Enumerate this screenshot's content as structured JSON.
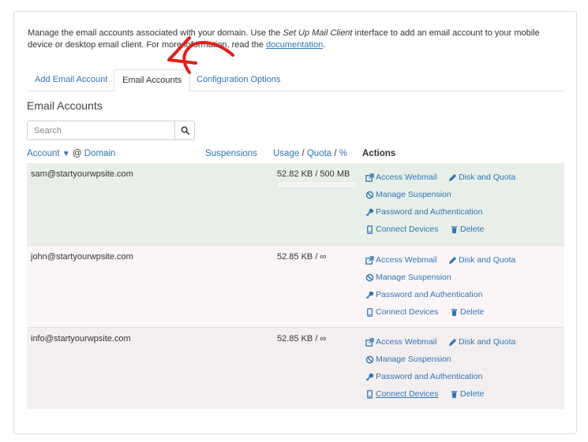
{
  "colors": {
    "link": "#2f75b5",
    "annotation_arrow": "#e0201b",
    "row_active": "#e8efe8"
  },
  "intro": {
    "text_before": "Manage the email accounts associated with your domain. Use the ",
    "em_text": "Set Up Mail Client",
    "text_middle": " interface to add an email account to your mobile device or desktop email client. For more information, read the ",
    "link_text": "documentation",
    "text_after": "."
  },
  "tabs": [
    {
      "label": "Add Email Account",
      "active": false
    },
    {
      "label": "Email Accounts",
      "active": true
    },
    {
      "label": "Configuration Options",
      "active": false
    }
  ],
  "section_title": "Email Accounts",
  "search": {
    "placeholder": "Search",
    "button_icon": "search-icon"
  },
  "table": {
    "headers": {
      "account": "Account",
      "sort_arrow": "▼",
      "at": "@",
      "domain": "Domain",
      "suspensions": "Suspensions",
      "usage": "Usage",
      "slash1": "/",
      "quota": "Quota",
      "slash2": "/",
      "percent": "%",
      "actions": "Actions"
    },
    "rows": [
      {
        "account": "sam@startyourwpsite.com",
        "usage": "52.82 KB / 500 MB",
        "has_bar": true,
        "usage_fraction": 0.0001
      },
      {
        "account": "john@startyourwpsite.com",
        "usage": "52.85 KB / ∞",
        "has_bar": false
      },
      {
        "account": "info@startyourwpsite.com",
        "usage": "52.85 KB / ∞",
        "has_bar": false
      }
    ],
    "actions": {
      "webmail": "Access Webmail",
      "disk": "Disk and Quota",
      "suspension": "Manage Suspension",
      "password": "Password and Authentication",
      "devices": "Connect Devices",
      "delete": "Delete"
    }
  }
}
